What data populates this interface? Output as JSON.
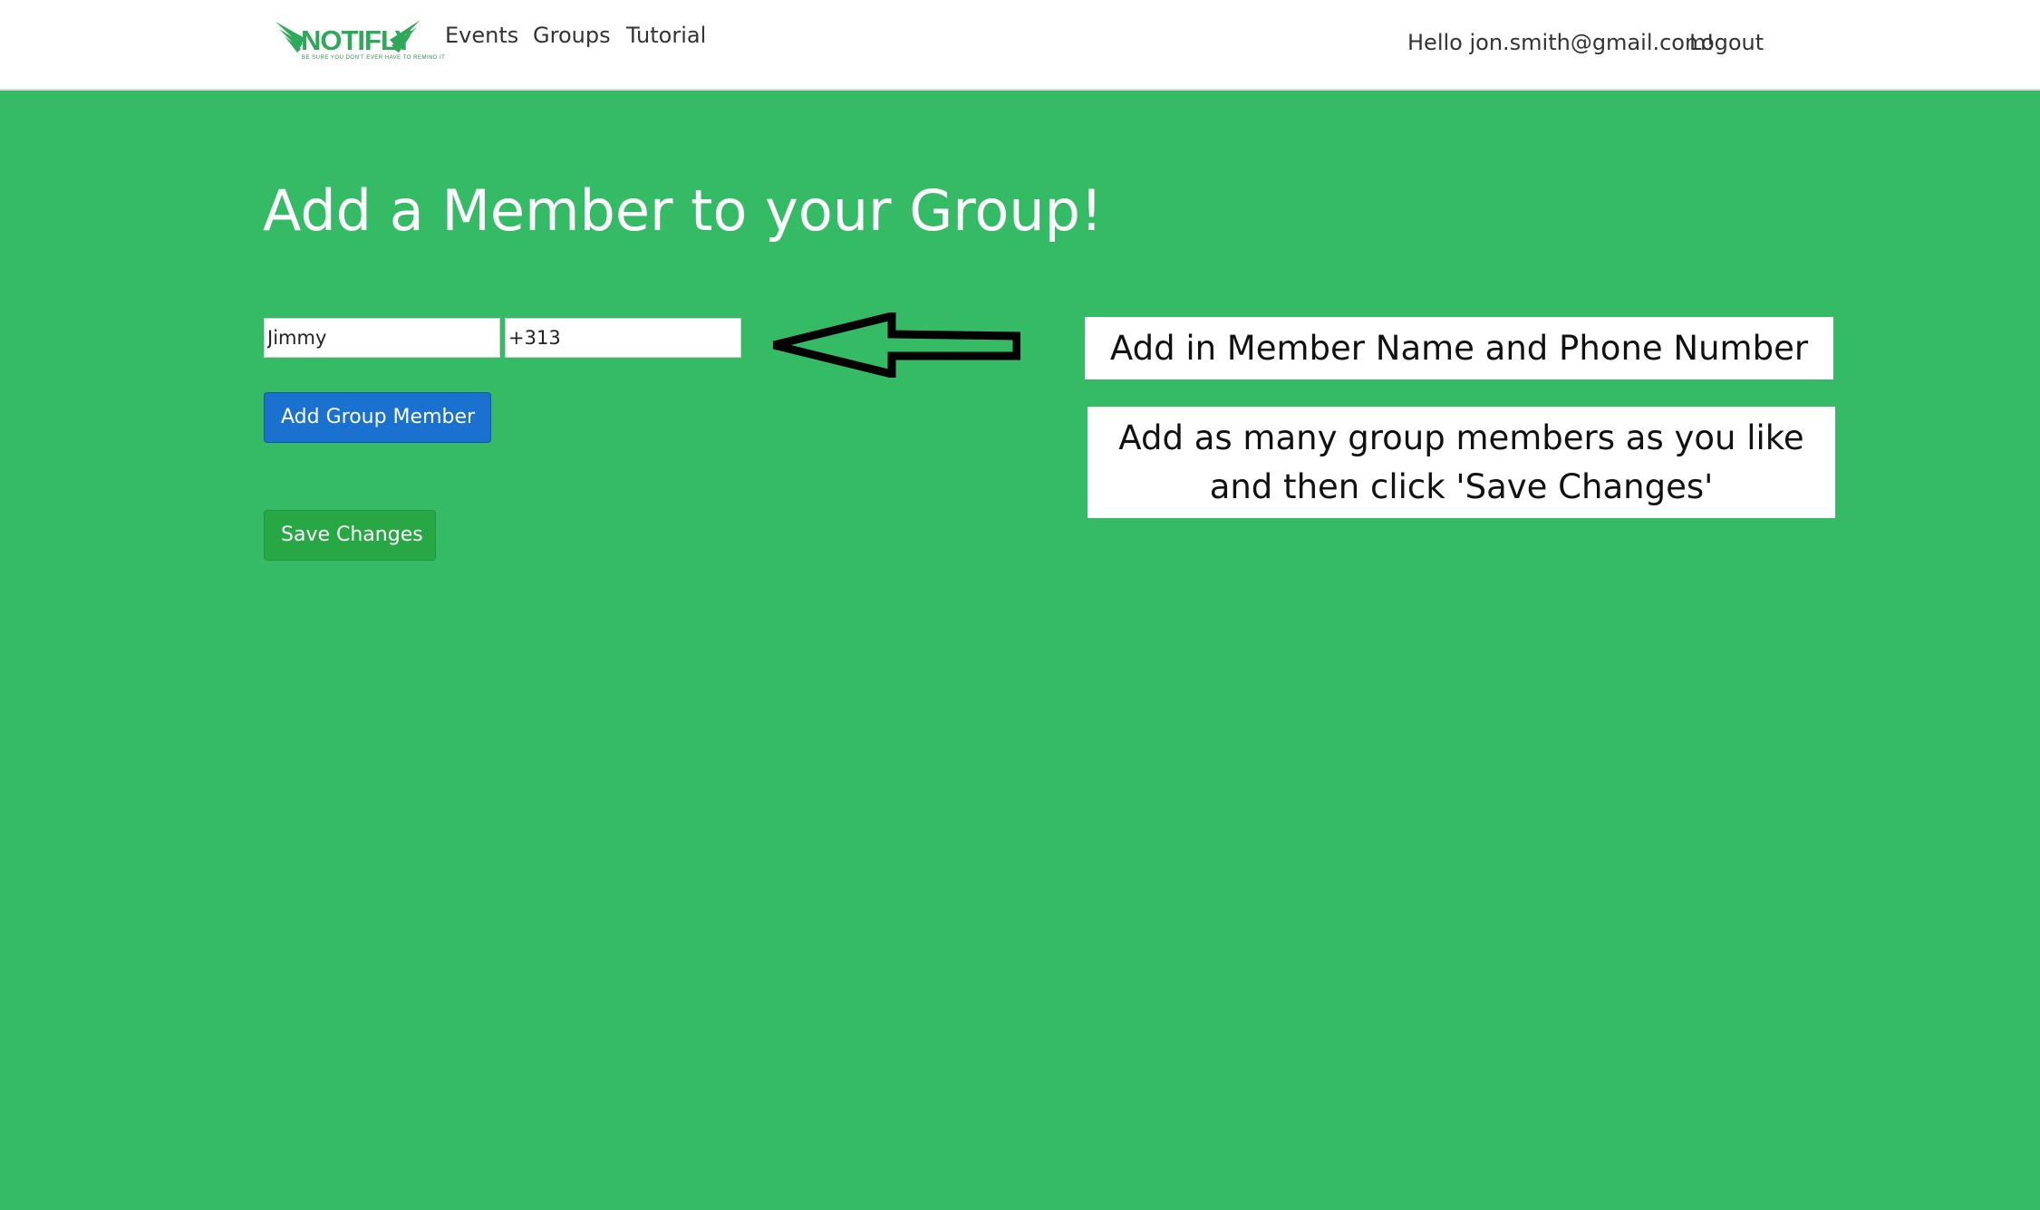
{
  "navbar": {
    "logo": {
      "name": "NOTIFLY",
      "tagline": "BE SURE YOU DON'T EVER HAVE TO REMIND IT"
    },
    "links": [
      {
        "label": "Events"
      },
      {
        "label": "Groups"
      },
      {
        "label": "Tutorial"
      }
    ],
    "greeting": "Hello jon.smith@gmail.com!",
    "logout_label": "Logout"
  },
  "main": {
    "title": "Add a Member to your Group!",
    "name_input": {
      "value": "Jimmy"
    },
    "phone_input": {
      "value": "+313"
    },
    "add_button_label": "Add Group Member",
    "save_button_label": "Save Changes"
  },
  "tutorial": {
    "callout_1": "Add in Member Name and Phone Number",
    "callout_2": "Add as many group members as you like and then click 'Save Changes'"
  },
  "colors": {
    "page_bg": "#35bb66",
    "navbar_bg": "#ffffff",
    "add_button": "#1a71d0",
    "save_button": "#28a745",
    "logo_green": "#2fa85a"
  },
  "icons": {
    "arrow": "left-arrow-outline-icon"
  }
}
